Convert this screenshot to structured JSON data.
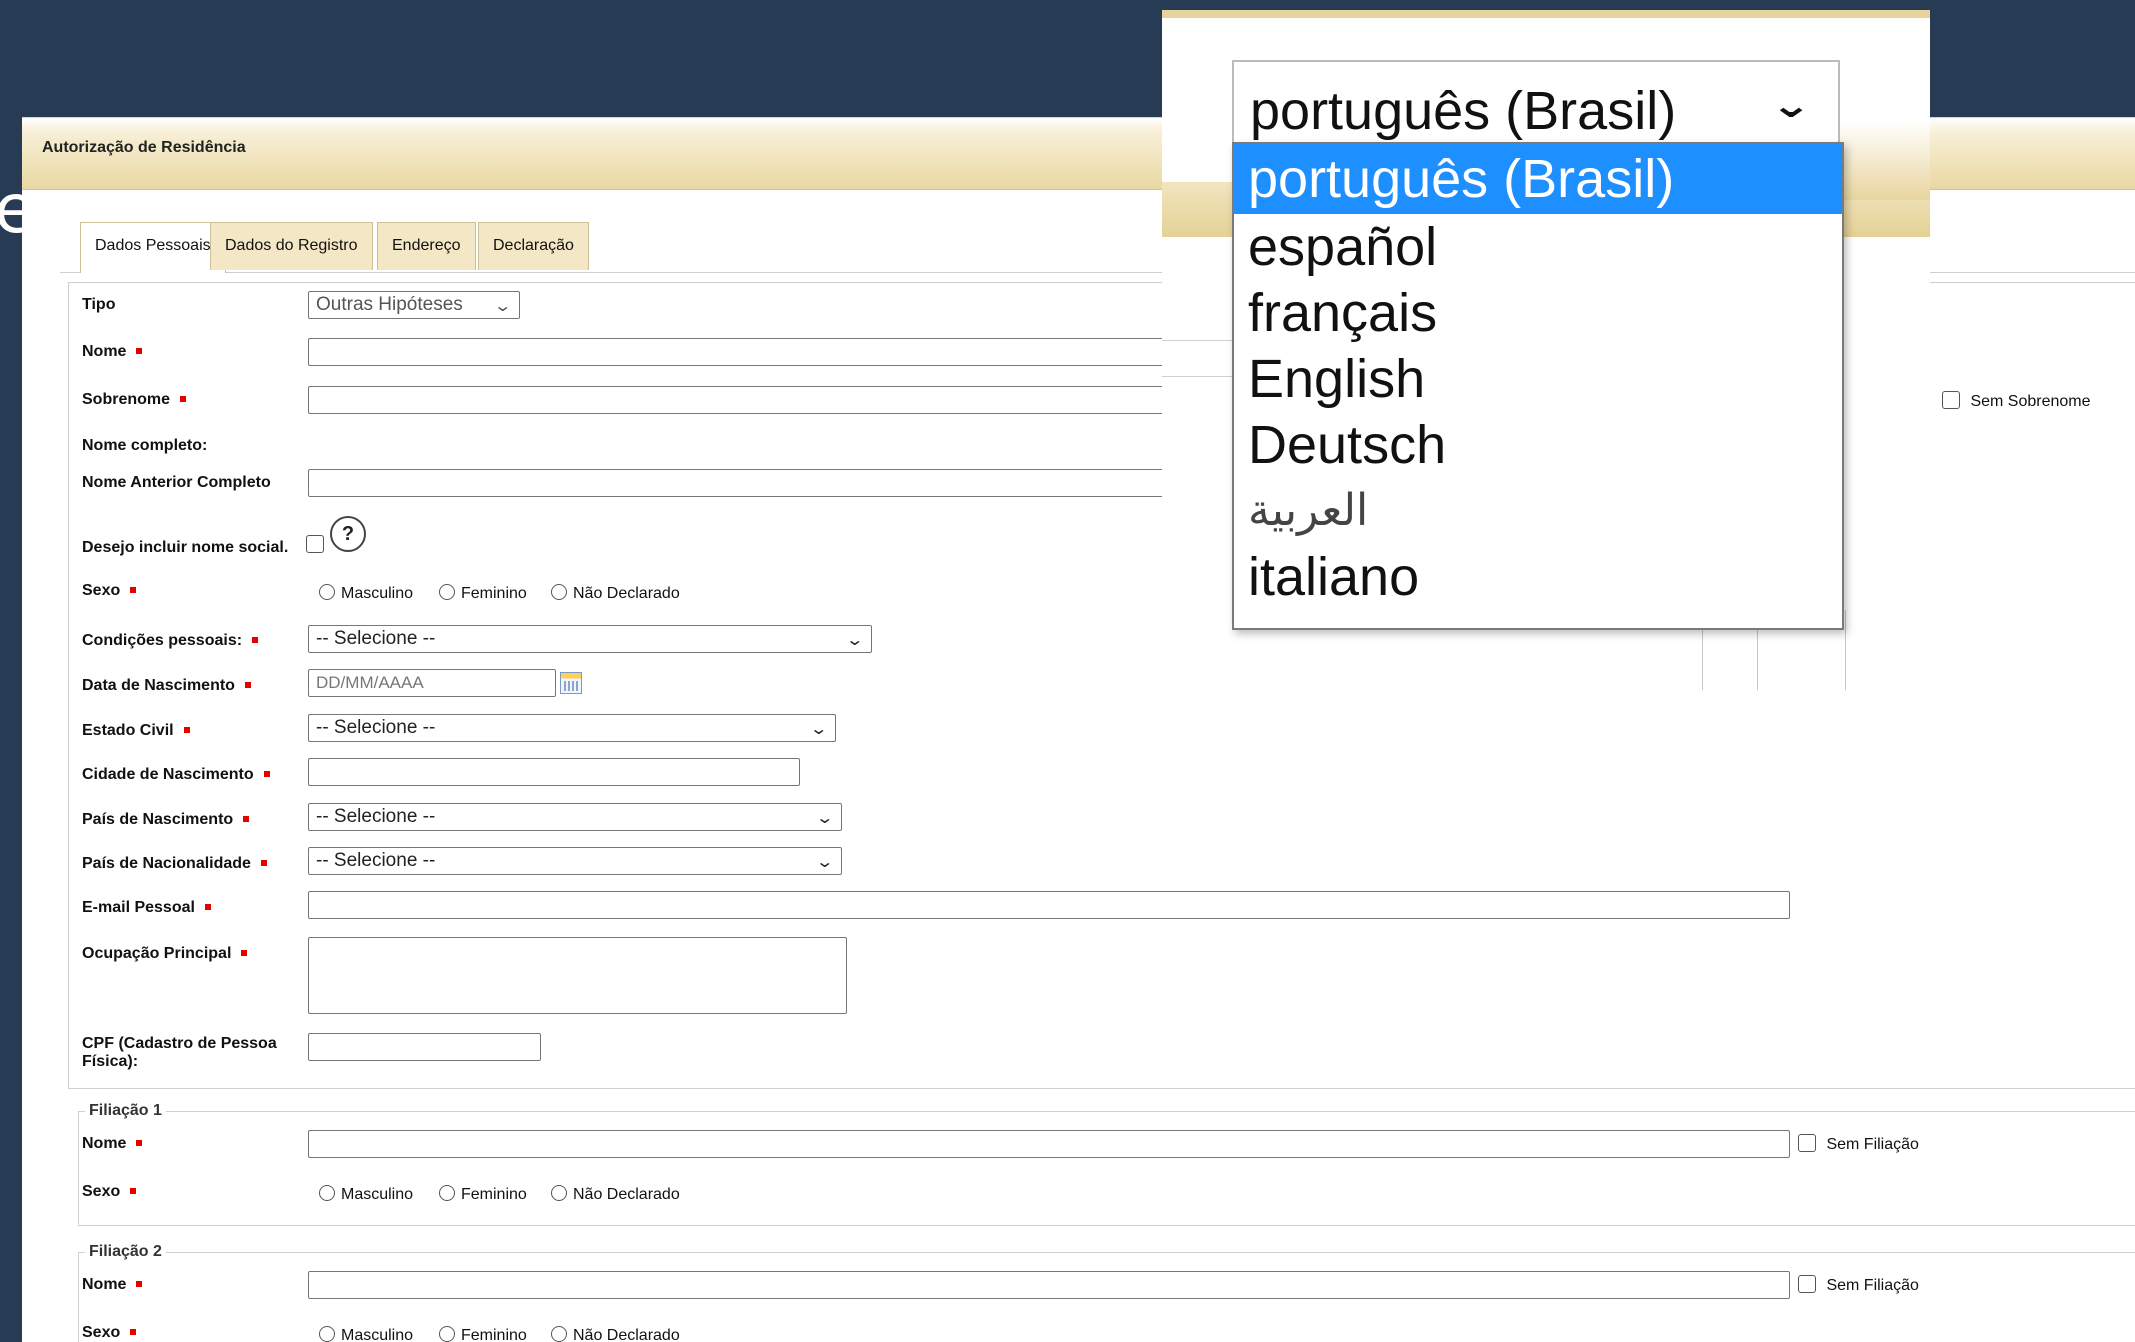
{
  "stray_char": "e",
  "panel": {
    "title": "Autorização de Residência"
  },
  "tabs": [
    {
      "label": "Dados Pessoais",
      "active": true
    },
    {
      "label": "Dados do Registro",
      "active": false
    },
    {
      "label": "Endereço",
      "active": false
    },
    {
      "label": "Declaração",
      "active": false
    }
  ],
  "form": {
    "tipo_label": "Tipo",
    "tipo_value": "Outras Hipóteses",
    "nome_label": "Nome",
    "sobrenome_label": "Sobrenome",
    "sem_sobrenome_label": "Sem Sobrenome",
    "nome_completo_label": "Nome completo:",
    "nome_anterior_label": "Nome Anterior Completo",
    "nome_social_label": "Desejo incluir nome social.",
    "help_glyph": "?",
    "sexo_label": "Sexo",
    "sexo_options": [
      "Masculino",
      "Feminino",
      "Não Declarado"
    ],
    "condicoes_label": "Condições pessoais:",
    "condicoes_value": "-- Selecione --",
    "nascimento_label": "Data de Nascimento",
    "nascimento_placeholder": "DD/MM/AAAA",
    "estado_civil_label": "Estado Civil",
    "estado_civil_value": "-- Selecione --",
    "cidade_label": "Cidade de Nascimento",
    "pais_nasc_label": "País de Nascimento",
    "pais_nasc_value": "-- Selecione --",
    "pais_nac_label": "País de Nacionalidade",
    "pais_nac_value": "-- Selecione --",
    "email_label": "E-mail Pessoal",
    "ocupacao_label": "Ocupação Principal",
    "cpf_label_line1": "CPF (Cadastro de Pessoa",
    "cpf_label_line2": "Física):"
  },
  "filiacao1": {
    "legend": "Filiação 1",
    "nome_label": "Nome",
    "sem_label": "Sem Filiação",
    "sexo_label": "Sexo",
    "sexo_options": [
      "Masculino",
      "Feminino",
      "Não Declarado"
    ]
  },
  "filiacao2": {
    "legend": "Filiação 2",
    "nome_label": "Nome",
    "sem_label": "Sem Filiação",
    "sexo_label": "Sexo",
    "sexo_options": [
      "Masculino",
      "Feminino",
      "Não Declarado"
    ]
  },
  "language": {
    "selected": "português (Brasil)",
    "options": [
      "português (Brasil)",
      "español",
      "français",
      "English",
      "Deutsch",
      "العربية",
      "italiano"
    ]
  },
  "colors": {
    "background": "#283b55",
    "highlight": "#1e8fff",
    "required_marker": "#e30000",
    "header_gold": "#ead8a3"
  }
}
